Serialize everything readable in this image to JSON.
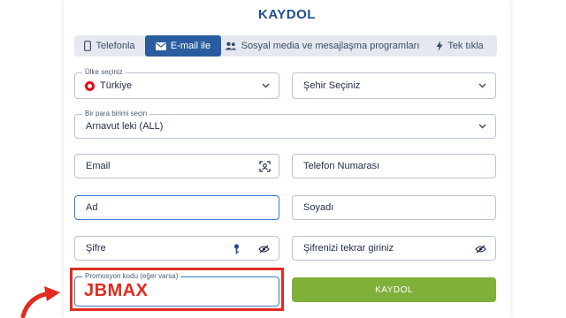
{
  "header": {
    "title": "KAYDOL"
  },
  "tabs": [
    {
      "label": "Telefonla",
      "icon": "phone-icon"
    },
    {
      "label": "E-mail ile",
      "icon": "envelope-icon"
    },
    {
      "label": "Sosyal media ve mesajlaşma programları",
      "icon": "users-icon"
    },
    {
      "label": "Tek tıkla",
      "icon": "lightning-icon"
    }
  ],
  "form": {
    "country": {
      "label": "Ülke seçiniz",
      "value": "Türkiye"
    },
    "city": {
      "placeholder": "Şehir Seçiniz"
    },
    "currency": {
      "label": "Bir para birimi seçin",
      "value": "Arnavut leki (ALL)"
    },
    "email": {
      "placeholder": "Email"
    },
    "phone": {
      "placeholder": "Telefon Numarası"
    },
    "first_name": {
      "placeholder": "Ad"
    },
    "last_name": {
      "placeholder": "Soyadı"
    },
    "password": {
      "placeholder": "Şifre"
    },
    "password_repeat": {
      "placeholder": "Şifrenizi tekrar giriniz"
    },
    "promo": {
      "label": "Promosyon kodu (eğer varsa)",
      "value": "JBMAX"
    },
    "submit_label": "KAYDOL"
  },
  "colors": {
    "accent": "#2a5d9f",
    "submit": "#7fb03a",
    "highlight": "#e12b1f"
  }
}
